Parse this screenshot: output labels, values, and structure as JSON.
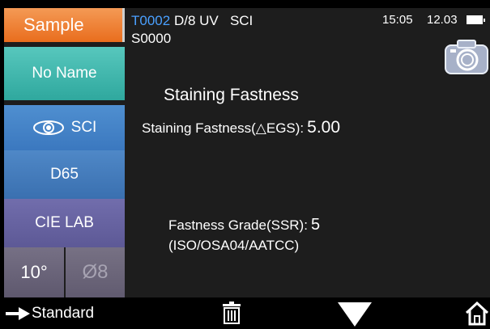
{
  "sidebar": {
    "sample_label": "Sample",
    "name_label": "No Name",
    "mode_label": "SCI",
    "illuminant_label": "D65",
    "color_space_label": "CIE LAB",
    "observer_label": "10°",
    "aperture_label": "Ø8"
  },
  "header": {
    "test_id": "T0002",
    "geometry": "D/8",
    "uv": "UV",
    "mode": "SCI",
    "sample_id": "S0000",
    "time": "15:05",
    "battery_value": "12.03"
  },
  "main": {
    "title": "Staining Fastness",
    "staining_label": "Staining Fastness(△EGS):",
    "staining_value": "5.00",
    "grade_label": "Fastness Grade(SSR):",
    "grade_value": "5",
    "standard": "(ISO/OSA04/AATCC)"
  },
  "bottom": {
    "standard_label": "Standard"
  },
  "icons": {
    "eye": "eye-icon",
    "camera": "camera-icon",
    "arrow": "arrow-right-icon",
    "trash": "trash-icon",
    "down": "triangle-down-icon",
    "home": "home-icon"
  },
  "colors": {
    "sample_orange": "#e96d1d",
    "name_teal": "#2fa89e",
    "blue": "#3b78bf",
    "purple": "#5d5996",
    "test_id_blue": "#4aa0ff"
  }
}
